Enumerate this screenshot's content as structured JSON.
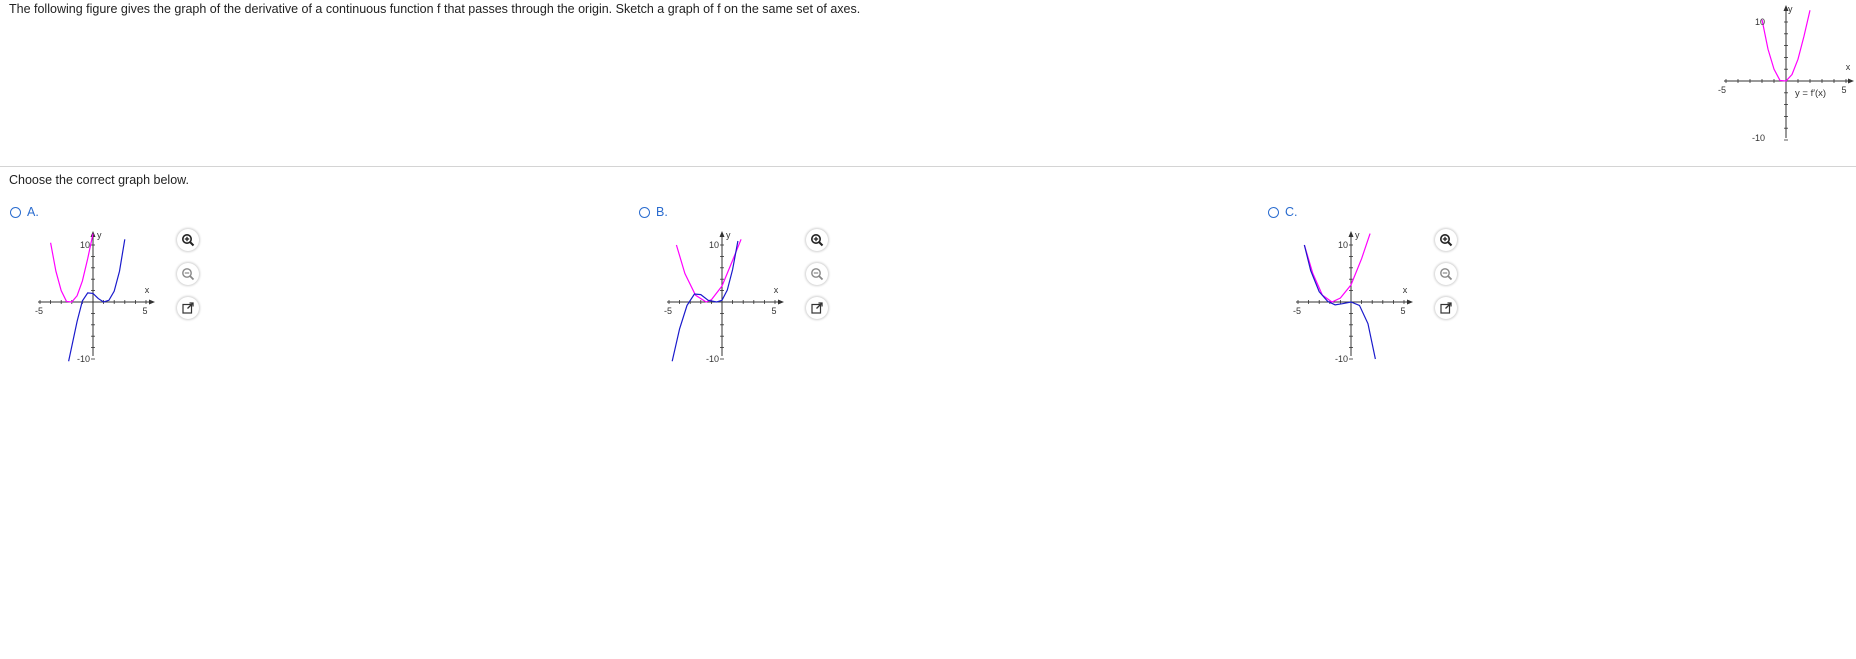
{
  "question": {
    "text": "The following figure gives the graph of the derivative of a continuous function f that passes through the origin. Sketch a graph of f on the same set of axes."
  },
  "main_graph": {
    "curve_label": "y = f′(x)",
    "axis_x": "x",
    "axis_y": "y",
    "tick_x_min": "-5",
    "tick_x_max": "5",
    "tick_y_max": "10",
    "tick_y_min": "-10"
  },
  "prompt": {
    "text": "Choose the correct graph below."
  },
  "small_axis": {
    "x": "x",
    "y": "y",
    "x_min": "-5",
    "x_max": "5",
    "y_max": "10",
    "y_min": "-10"
  },
  "options": [
    {
      "label": "A.",
      "selected": false
    },
    {
      "label": "B.",
      "selected": false
    },
    {
      "label": "C.",
      "selected": false
    }
  ],
  "tools": {
    "zoom_in": "zoom-in-icon",
    "zoom_out": "zoom-out-icon",
    "open_new": "open-new-window-icon"
  },
  "colors": {
    "derivative_curve": "#ff00ff",
    "candidate_curve": "#1a1acc",
    "accent": "#2a6ccf",
    "axis": "#333333"
  },
  "chart_data": [
    {
      "type": "line",
      "name": "main",
      "xlim": [
        -5,
        5
      ],
      "ylim": [
        -10,
        10
      ],
      "series": [
        {
          "name": "y = f′(x)",
          "color": "#ff00ff",
          "points": [
            [
              -2,
              10.4
            ],
            [
              -1.5,
              5.4
            ],
            [
              -1,
              2
            ],
            [
              -0.5,
              0.1
            ],
            [
              0,
              0
            ],
            [
              0.5,
              1.1
            ],
            [
              1,
              3.7
            ],
            [
              1.5,
              7.6
            ],
            [
              2,
              12
            ]
          ]
        }
      ]
    },
    {
      "type": "line",
      "name": "A",
      "xlim": [
        -5,
        5
      ],
      "ylim": [
        -10,
        10
      ],
      "series": [
        {
          "color": "#ff00ff",
          "points": [
            [
              -4,
              10.4
            ],
            [
              -3.5,
              5.4
            ],
            [
              -3,
              2
            ],
            [
              -2.5,
              0.1
            ],
            [
              -2,
              0
            ],
            [
              -1.5,
              1.1
            ],
            [
              -1,
              3.7
            ],
            [
              -0.5,
              7.6
            ],
            [
              0,
              12
            ]
          ]
        },
        {
          "color": "#1a1acc",
          "points": [
            [
              -2.3,
              -10.4
            ],
            [
              -1.5,
              -3.4
            ],
            [
              -1,
              0.2
            ],
            [
              -0.5,
              1.6
            ],
            [
              0,
              1.5
            ],
            [
              0.5,
              0.6
            ],
            [
              1,
              0
            ],
            [
              1.5,
              0.3
            ],
            [
              2,
              1.9
            ],
            [
              2.5,
              5.4
            ],
            [
              3,
              11
            ]
          ]
        }
      ]
    },
    {
      "type": "line",
      "name": "B",
      "xlim": [
        -5,
        5
      ],
      "ylim": [
        -10,
        10
      ],
      "series": [
        {
          "color": "#ff00ff",
          "points": [
            [
              -4.3,
              10
            ],
            [
              -3.5,
              5
            ],
            [
              -2.5,
              1.2
            ],
            [
              -1.5,
              0
            ],
            [
              -1,
              0.4
            ],
            [
              0,
              2.8
            ],
            [
              1,
              7.3
            ],
            [
              1.8,
              11
            ]
          ]
        },
        {
          "color": "#1a1acc",
          "points": [
            [
              -4.7,
              -10.4
            ],
            [
              -4,
              -4.7
            ],
            [
              -3.3,
              -0.6
            ],
            [
              -2.6,
              1.4
            ],
            [
              -2,
              1.3
            ],
            [
              -1.3,
              0.3
            ],
            [
              -0.5,
              0
            ],
            [
              0,
              0.3
            ],
            [
              0.5,
              2.1
            ],
            [
              1,
              5.7
            ],
            [
              1.5,
              10.7
            ]
          ]
        }
      ]
    },
    {
      "type": "line",
      "name": "C",
      "xlim": [
        -5,
        5
      ],
      "ylim": [
        -10,
        10
      ],
      "series": [
        {
          "color": "#ff00ff",
          "points": [
            [
              -4.4,
              10
            ],
            [
              -3.6,
              5
            ],
            [
              -2.7,
              1.2
            ],
            [
              -1.8,
              0
            ],
            [
              -1,
              0.7
            ],
            [
              0,
              3
            ],
            [
              1,
              7.6
            ],
            [
              1.8,
              12
            ]
          ]
        },
        {
          "color": "#1a1acc",
          "points": [
            [
              -4.4,
              10
            ],
            [
              -3.8,
              5.5
            ],
            [
              -3,
              1.8
            ],
            [
              -2.2,
              0.1
            ],
            [
              -1.5,
              -0.5
            ],
            [
              -0.8,
              -0.3
            ],
            [
              0,
              0
            ],
            [
              0.8,
              -0.6
            ],
            [
              1.6,
              -3.8
            ],
            [
              2.3,
              -10
            ]
          ]
        }
      ]
    }
  ]
}
